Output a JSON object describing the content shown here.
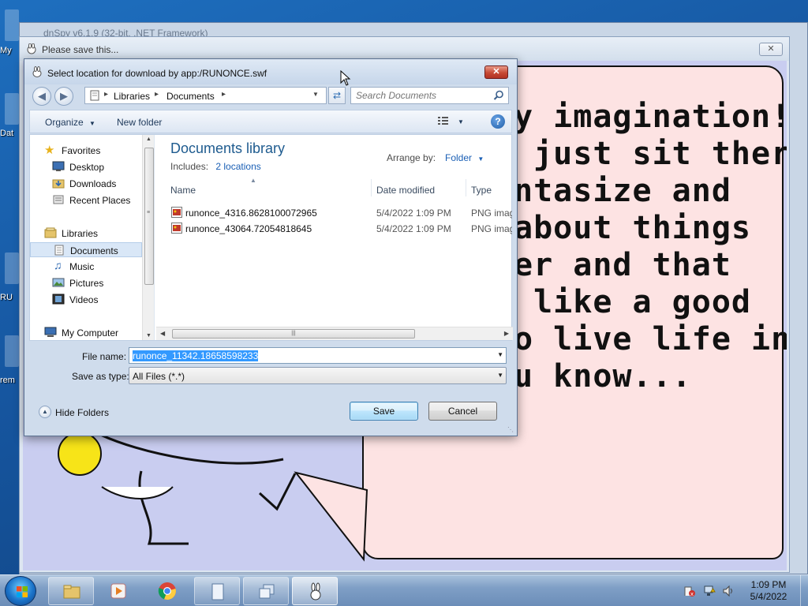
{
  "desktop": {
    "icon_labels": [
      "My",
      "Dat",
      "RU",
      "rem"
    ]
  },
  "background_app": {
    "title": "dnSpy v6.1.9 (32-bit, .NET Framework)"
  },
  "flash_window": {
    "title": "Please save this...",
    "close_label": "✕",
    "speech_text": "y imagination!\n just sit there\nntasize and\nabout things\ner and that\n like a good\no live life in,\nu know..."
  },
  "dialog": {
    "title": "Select location for download by app:/RUNONCE.swf",
    "close_label": "✕",
    "address": {
      "crumbs": [
        "Libraries",
        "Documents"
      ]
    },
    "search": {
      "placeholder": "Search Documents"
    },
    "toolbar": {
      "organize": "Organize",
      "new_folder": "New folder"
    },
    "nav": {
      "favorites": "Favorites",
      "desktop": "Desktop",
      "downloads": "Downloads",
      "recent": "Recent Places",
      "libraries": "Libraries",
      "documents": "Documents",
      "music": "Music",
      "pictures": "Pictures",
      "videos": "Videos",
      "computer": "My Computer"
    },
    "library": {
      "title": "Documents library",
      "includes_label": "Includes:",
      "includes_link": "2 locations",
      "arrange_label": "Arrange by:",
      "arrange_value": "Folder"
    },
    "columns": {
      "name": "Name",
      "date": "Date modified",
      "type": "Type"
    },
    "files": [
      {
        "name": "runonce_4316.8628100072965",
        "date": "5/4/2022 1:09 PM",
        "type": "PNG imag"
      },
      {
        "name": "runonce_43064.72054818645",
        "date": "5/4/2022 1:09 PM",
        "type": "PNG imag"
      }
    ],
    "scroll_grip": "|||",
    "file_name_label": "File name:",
    "file_name_value": "runonce_11342.18658598233",
    "save_type_label": "Save as type:",
    "save_type_value": "All Files (*.*)",
    "hide_folders": "Hide Folders",
    "save_button": "Save",
    "cancel_button": "Cancel"
  },
  "taskbar": {
    "time": "1:09 PM",
    "date": "5/4/2022"
  }
}
